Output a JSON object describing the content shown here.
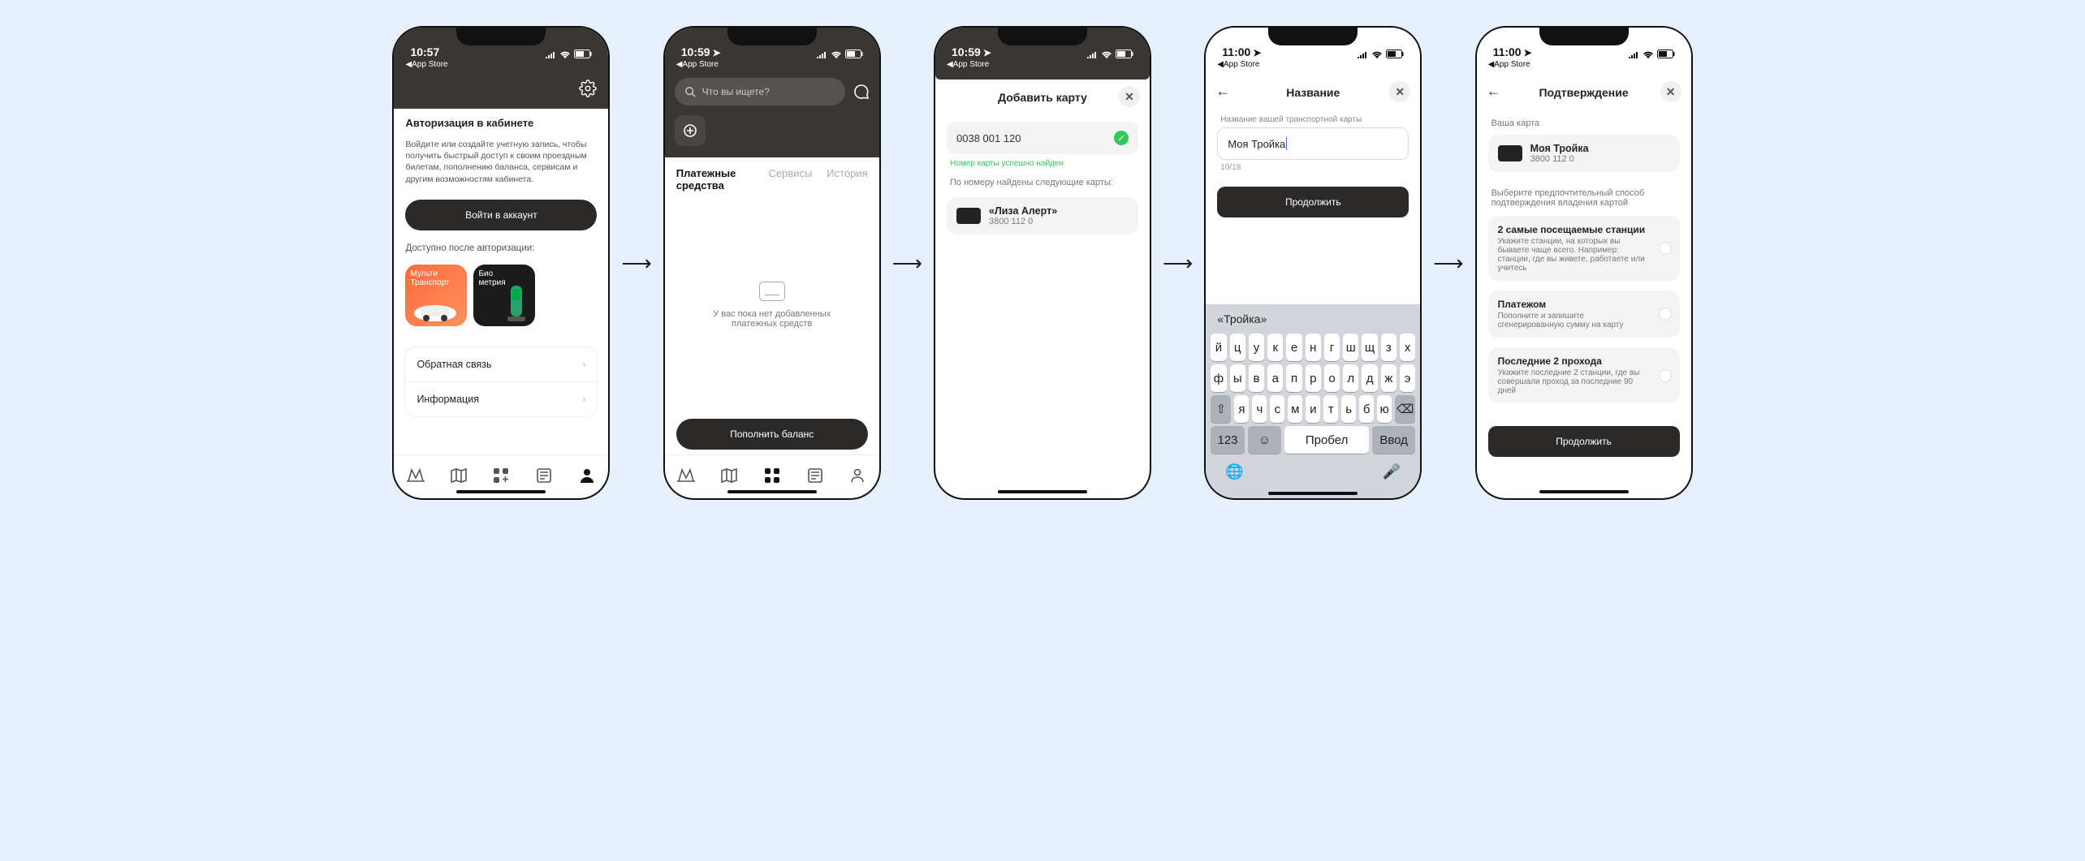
{
  "status": {
    "t1": "10:57",
    "t2": "10:59",
    "t3": "10:59",
    "t4": "11:00",
    "t5": "11:00",
    "back": "App Store"
  },
  "s1": {
    "auth_title": "Авторизация в кабинете",
    "auth_desc": "Войдите или создайте учетную запись, чтобы получить быстрый доступ к своим проездным билетам, пополнению баланса, сервисам и другим возможностям кабинета.",
    "login_btn": "Войти в аккаунт",
    "avail_label": "Доступно после авторизации:",
    "promo1": "Мульти\nТранспорт",
    "promo2": "Био\nметрия",
    "feedback": "Обратная связь",
    "info": "Информация"
  },
  "s2": {
    "search_placeholder": "Что вы ищете?",
    "tab_pay": "Платежные средства",
    "tab_srv": "Сервисы",
    "tab_hist": "История",
    "empty": "У вас пока нет добавленных\nплатежных средств",
    "topup": "Пополнить баланс"
  },
  "s3": {
    "title": "Добавить карту",
    "card_no": "0038 001 120",
    "ok_hint": "Номер карты успешно найден",
    "found_hint": "По номеру найдены следующие карты:",
    "found_name": "«Лиза Алерт»",
    "found_num": "3800 112 0"
  },
  "s4": {
    "title": "Название",
    "field_label": "Название вашей транспортной карты",
    "value": "Моя Тройка",
    "counter": "10/18",
    "cont": "Продолжить",
    "suggest": "«Тройка»",
    "row1": [
      "й",
      "ц",
      "у",
      "к",
      "е",
      "н",
      "г",
      "ш",
      "щ",
      "з",
      "х"
    ],
    "row2": [
      "ф",
      "ы",
      "в",
      "а",
      "п",
      "р",
      "о",
      "л",
      "д",
      "ж",
      "э"
    ],
    "row3": [
      "я",
      "ч",
      "с",
      "м",
      "и",
      "т",
      "ь",
      "б",
      "ю"
    ],
    "k123": "123",
    "space": "Пробел",
    "enter": "Ввод"
  },
  "s5": {
    "title": "Подтверждение",
    "your_card": "Ваша карта",
    "card_name": "Моя Тройка",
    "card_num": "3800 112 0",
    "choose": "Выберите предпочтительный способ подтверждения владения картой",
    "o1t": "2 самые посещаемые станции",
    "o1d": "Укажите станции, на которых вы бываете чаще всего. Например: станции, где вы живете, работаете или учитесь",
    "o2t": "Платежом",
    "o2d": "Пополните и запишите сгенерированную сумму на карту",
    "o3t": "Последние 2 прохода",
    "o3d": "Укажите последние 2 станции, где вы совершали проход за последние 90 дней",
    "cont": "Продолжить"
  }
}
